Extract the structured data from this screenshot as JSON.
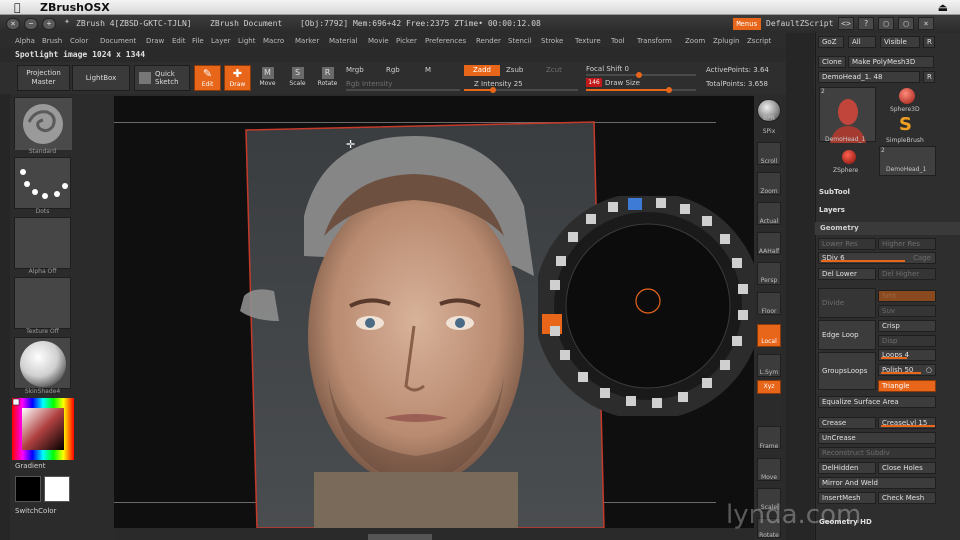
{
  "mac_menubar": {
    "app_name": "ZBrushOSX"
  },
  "titlebar": {
    "app": "ZBrush 4[ZBSD-GKTC-TJLN]",
    "document": "ZBrush Document",
    "stats": "[Obj:7792] Mem:696+42 Free:2375 ZTime• 00:00:12.08",
    "menus": "Menus",
    "default_zscript": "DefaultZScript",
    "buttons": [
      "<>",
      "?",
      "▢",
      "▢",
      "×"
    ]
  },
  "main_menu": [
    "Alpha",
    "Brush",
    "Color",
    "Document",
    "Draw",
    "Edit",
    "File",
    "Layer",
    "Light",
    "Macro",
    "Marker",
    "Material",
    "Movie",
    "Picker",
    "Preferences",
    "Render",
    "Stencil",
    "Stroke",
    "Texture",
    "Tool",
    "Transform",
    "Zoom",
    "Zplugin",
    "Zscript"
  ],
  "spotlight_label": "Spotlight image 1024 x 1344",
  "top_shelf": {
    "projection_master": "Projection Master",
    "lightbox": "LightBox",
    "quick_sketch": "Quick Sketch",
    "edit": "Edit",
    "draw": "Draw",
    "move": "Move",
    "scale": "Scale",
    "rotate": "Rotate",
    "mrgb": "Mrgb",
    "rgb": "Rgb",
    "m": "M",
    "rgb_intensity": "Rgb Intensity",
    "zadd": "Zadd",
    "zsub": "Zsub",
    "zcut": "Zcut",
    "z_intensity": "Z Intensity 25",
    "focal_shift": "Focal Shift 0",
    "draw_size_value": "146",
    "draw_size": "Draw Size",
    "active_points": "ActivePoints: 3.64",
    "total_points": "TotalPoints: 3.658"
  },
  "left_shelf": {
    "brush_caption": "Standard",
    "stroke_caption": "Dots",
    "alpha_caption": "Alpha Off",
    "texture_caption": "Texture Off",
    "material_caption": "SkinShade4",
    "gradient": "Gradient",
    "switch_color": "SwitchColor",
    "colors": {
      "main": "#000000",
      "secondary": "#ffffff"
    }
  },
  "right_shelf": [
    "BPR",
    "SPix",
    "Scroll",
    "Zoom",
    "Actual",
    "AAHalf",
    "Persp",
    "Floor",
    "Local",
    "L.Sym",
    "Xyz",
    "Frame",
    "Move",
    "Scale",
    "Rotate"
  ],
  "tool_palette": {
    "top_buttons": [
      "GoZ",
      "All",
      "Visible",
      "R"
    ],
    "clone": "Clone",
    "make_polymesh": "Make PolyMesh3D",
    "current_tool": "DemoHead_1. 48",
    "r": "R",
    "tools": [
      {
        "count": "2",
        "caption": "DemoHead_1"
      },
      {
        "caption": "Sphere3D"
      },
      {
        "caption": "SimpleBrush"
      },
      {
        "caption": "ZSphere"
      },
      {
        "count": "2",
        "caption": "DemoHead_1"
      }
    ],
    "subtool": "SubTool",
    "layers": "Layers",
    "geometry": "Geometry",
    "lower_res": "Lower Res",
    "higher_res": "Higher Res",
    "sdiv": "SDiv 6",
    "cage": "Cage",
    "del_lower": "Del Lower",
    "del_higher": "Del Higher",
    "divide": "Divide",
    "smt": "Smt",
    "suv": "Suv",
    "edge_loop": "Edge Loop",
    "crisp": "Crisp",
    "disp": "Disp",
    "groups_loops": "GroupsLoops",
    "loops": "Loops 4",
    "polish": "Polish 50",
    "triangle": "Triangle",
    "equalize": "Equalize Surface Area",
    "crease": "Crease",
    "crease_lvl": "CreaseLvl 15",
    "uncrease": "UnCrease",
    "reconstruct": "Reconstruct Subdiv",
    "del_hidden": "DelHidden",
    "close_holes": "Close Holes",
    "mirror_weld": "Mirror And Weld",
    "insert_mesh": "InsertMesh",
    "check_mesh": "Check Mesh",
    "geometry_hd": "Geometry HD"
  },
  "watermark": "lynda.com",
  "accent_color": "#e8661a"
}
